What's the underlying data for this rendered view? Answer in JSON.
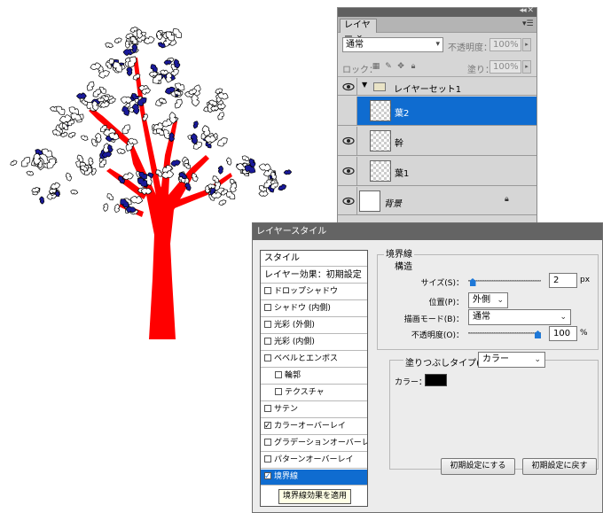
{
  "layers_panel": {
    "tab_label": "レイヤー",
    "menu_icon": "panel-menu-icon",
    "blend_mode": "通常",
    "opacity_label": "不透明度：",
    "opacity_value": "100%",
    "lock_label": "ロック：",
    "fill_label": "塗り：",
    "fill_value": "100%",
    "layers": [
      {
        "name": "レイヤーセット1",
        "type": "group",
        "selected": false
      },
      {
        "name": "葉2",
        "type": "layer",
        "selected": true
      },
      {
        "name": "幹",
        "type": "layer",
        "selected": false
      },
      {
        "name": "葉1",
        "type": "layer",
        "selected": false
      },
      {
        "name": "背景",
        "type": "background",
        "selected": false
      }
    ]
  },
  "dialog": {
    "title": "レイヤースタイル",
    "list_header": "スタイル",
    "list_preset": "レイヤー効果：初期設定",
    "effects": [
      {
        "label": "ドロップシャドウ",
        "checked": false
      },
      {
        "label": "シャドウ (内側)",
        "checked": false
      },
      {
        "label": "光彩 (外側)",
        "checked": false
      },
      {
        "label": "光彩 (内側)",
        "checked": false
      },
      {
        "label": "ベベルとエンボス",
        "checked": false
      },
      {
        "label": "輪郭",
        "checked": false
      },
      {
        "label": "テクスチャ",
        "checked": false
      },
      {
        "label": "サテン",
        "checked": false
      },
      {
        "label": "カラーオーバーレイ",
        "checked": true
      },
      {
        "label": "グラデーションオーバーレイ",
        "checked": false
      },
      {
        "label": "パターンオーバーレイ",
        "checked": false
      },
      {
        "label": "境界線",
        "checked": true
      }
    ],
    "tooltip": "境界線効果を適用",
    "section_title": "境界線",
    "structure_title": "構造",
    "size_label": "サイズ(S)：",
    "size_value": "2",
    "size_unit": "px",
    "position_label": "位置(P)：",
    "position_value": "外側",
    "blend_label": "描画モード(B)：",
    "blend_value": "通常",
    "opacity_label": "不透明度(O)：",
    "opacity_value": "100",
    "opacity_unit": "%",
    "fill_type_label": "塗りつぶしタイプ(F)：",
    "fill_type_value": "カラー",
    "color_label": "カラー：",
    "color_value": "#000000",
    "make_default_label": "初期設定にする",
    "reset_default_label": "初期設定に戻す",
    "size_fraction": 0.02,
    "opacity_fraction": 1.0
  },
  "colors": {
    "accent": "#0f6cd0",
    "trunk": "#ff0000",
    "leaf_shadow": "#1a1a9a"
  }
}
